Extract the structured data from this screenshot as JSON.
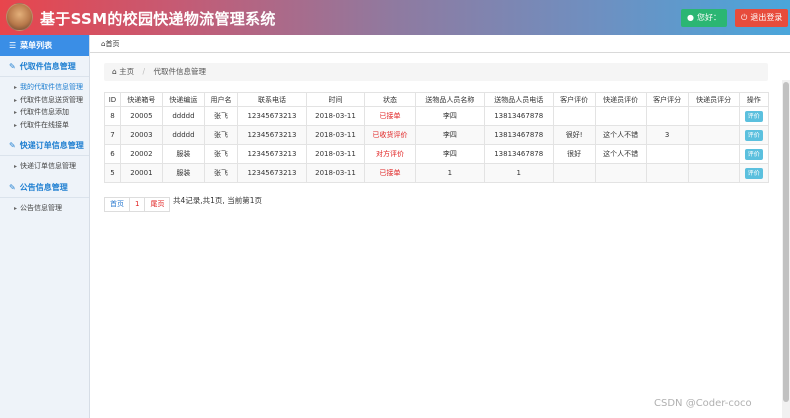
{
  "app": {
    "title": "基于SSM的校园快递物流管理系统"
  },
  "topbar": {
    "user_label": "您好：",
    "logout_label": "退出登录",
    "user_icon": "user-icon",
    "logout_icon": "power-icon"
  },
  "sidebar": {
    "header": "菜单列表",
    "groups": [
      {
        "title": "代取件信息管理",
        "items": [
          "我的代取件信息管理",
          "代取件信息送货管理",
          "代取件信息添加",
          "代取件在线接单"
        ]
      },
      {
        "title": "快递订单信息管理",
        "items": [
          "快递订单信息管理"
        ]
      },
      {
        "title": "公告信息管理",
        "items": [
          "公告信息管理"
        ]
      }
    ]
  },
  "breadcrumb": {
    "top": "首页",
    "home": "主页",
    "current": "代取件信息管理"
  },
  "table": {
    "headers": [
      "ID",
      "快递箱号",
      "快递编运",
      "用户名",
      "联系电话",
      "时间",
      "状态",
      "送物品人员名称",
      "送物品人员电话",
      "客户评价",
      "快递员评价",
      "客户评分",
      "快递员评分",
      "操作"
    ],
    "rows": [
      {
        "id": "8",
        "box": "20005",
        "code": "ddddd",
        "user": "张飞",
        "phone": "12345673213",
        "time": "2018-03-11",
        "status": "已接单",
        "sender": "李四",
        "sender_phone": "13813467878",
        "cust_eval": "",
        "courier_eval": "",
        "cust_score": "",
        "courier_score": "",
        "action": "评价"
      },
      {
        "id": "7",
        "box": "20003",
        "code": "ddddd",
        "user": "张飞",
        "phone": "12345673213",
        "time": "2018-03-11",
        "status": "已收货评价",
        "sender": "李四",
        "sender_phone": "13813467878",
        "cust_eval": "很好!",
        "courier_eval": "这个人不错",
        "cust_score": "3",
        "courier_score": "",
        "action": "评价"
      },
      {
        "id": "6",
        "box": "20002",
        "code": "服装",
        "user": "张飞",
        "phone": "12345673213",
        "time": "2018-03-11",
        "status": "对方评价",
        "sender": "李四",
        "sender_phone": "13813467878",
        "cust_eval": "很好",
        "courier_eval": "这个人不错",
        "cust_score": "",
        "courier_score": "",
        "action": "评价"
      },
      {
        "id": "5",
        "box": "20001",
        "code": "服装",
        "user": "张飞",
        "phone": "12345673213",
        "time": "2018-03-11",
        "status": "已接单",
        "sender": "1",
        "sender_phone": "1",
        "cust_eval": "",
        "courier_eval": "",
        "cust_score": "",
        "courier_score": "",
        "action": "评价"
      }
    ]
  },
  "pager": {
    "first": "首页",
    "current": "1",
    "last": "尾页",
    "info": "共4记录,共1页, 当前第1页"
  },
  "watermark": "CSDN @Coder-coco",
  "colors": {
    "status": "#e02020",
    "accent": "#3a8ee6"
  }
}
